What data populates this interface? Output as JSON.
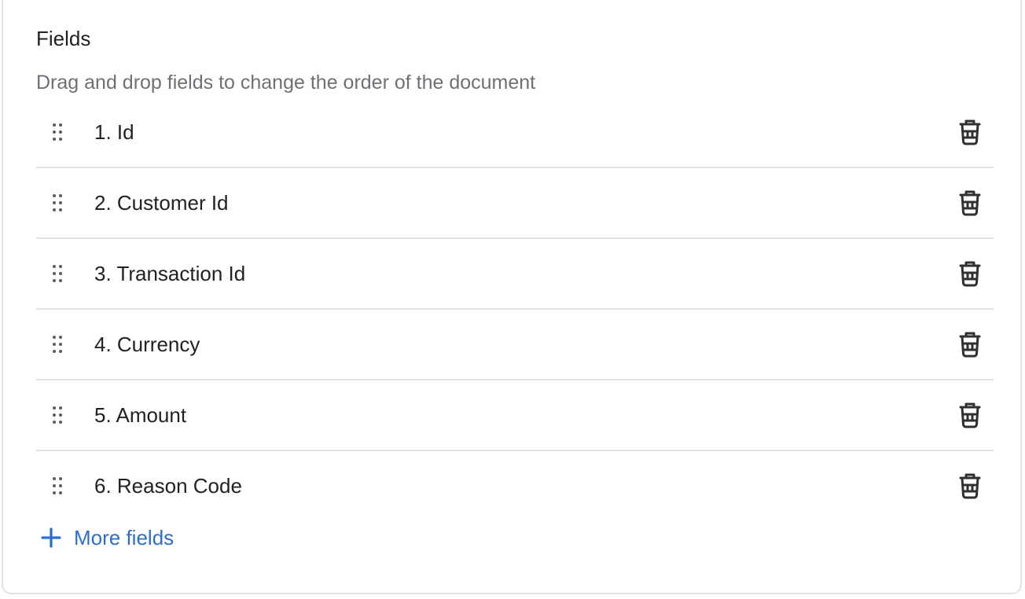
{
  "card": {
    "title": "Fields",
    "subtitle": "Drag and drop fields to change the order of the document"
  },
  "fields": [
    {
      "label": "1. Id",
      "drag_icon": "drag-handle-icon",
      "delete_icon": "trash-icon"
    },
    {
      "label": "2. Customer Id",
      "drag_icon": "drag-handle-icon",
      "delete_icon": "trash-icon"
    },
    {
      "label": "3. Transaction Id",
      "drag_icon": "drag-handle-icon",
      "delete_icon": "trash-icon"
    },
    {
      "label": "4. Currency",
      "drag_icon": "drag-handle-icon",
      "delete_icon": "trash-icon"
    },
    {
      "label": "5. Amount",
      "drag_icon": "drag-handle-icon",
      "delete_icon": "trash-icon"
    },
    {
      "label": "6. Reason Code",
      "drag_icon": "drag-handle-icon",
      "delete_icon": "trash-icon"
    }
  ],
  "more_fields": {
    "label": "More fields",
    "icon": "plus-icon"
  },
  "colors": {
    "text": "#202223",
    "subdued_text": "#6d7175",
    "link": "#2c6ecb",
    "border": "#e1e3e5",
    "icon": "#5c5f62"
  }
}
